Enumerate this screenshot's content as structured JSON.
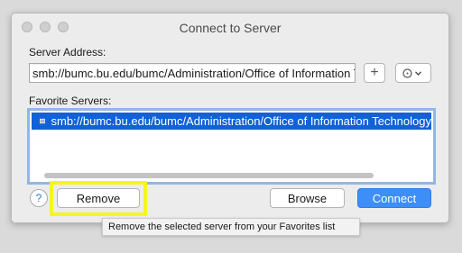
{
  "window": {
    "title": "Connect to Server"
  },
  "server_address": {
    "label": "Server Address:",
    "value": "smb://bumc.bu.edu/bumc/Administration/Office of Information Technology"
  },
  "favorites": {
    "label": "Favorite Servers:",
    "items": [
      {
        "label": "smb://bumc.bu.edu/bumc/Administration/Office of Information Technology",
        "selected": true
      }
    ]
  },
  "buttons": {
    "add": "+",
    "help": "?",
    "remove": "Remove",
    "browse": "Browse",
    "connect": "Connect"
  },
  "tooltip": {
    "text": "Remove the selected server from your Favorites list"
  },
  "icons": {
    "add": "plus-icon",
    "action": "gear-icon",
    "drive": "network-drive-icon"
  },
  "colors": {
    "accent": "#3d8ef7",
    "selection": "#1261d6",
    "highlight": "#f7f51e"
  }
}
